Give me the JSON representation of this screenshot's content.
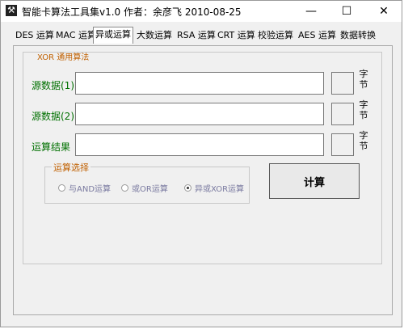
{
  "window": {
    "title": "智能卡算法工具集v1.0 作者：余彦飞 2010-08-25",
    "minimize_icon": "minimize-icon",
    "maximize_icon": "maximize-icon",
    "close_icon": "close-icon"
  },
  "tabs": [
    {
      "label": "DES 运算"
    },
    {
      "label": "MAC 运算"
    },
    {
      "label": "异或运算",
      "active": true
    },
    {
      "label": "大数运算"
    },
    {
      "label": "RSA 运算"
    },
    {
      "label": "CRT 运算"
    },
    {
      "label": "校验运算"
    },
    {
      "label": "AES 运算"
    },
    {
      "label": "数据转换"
    }
  ],
  "xor": {
    "group_title": "XOR 通用算法",
    "rows": [
      {
        "label": "源数据(1)",
        "value": "",
        "length": "",
        "unit": "字节"
      },
      {
        "label": "源数据(2)",
        "value": "",
        "length": "",
        "unit": "字节"
      },
      {
        "label": "运算结果",
        "value": "",
        "length": "",
        "unit": "字节"
      }
    ],
    "op_title": "运算选择",
    "options": [
      {
        "label": "与AND运算",
        "selected": false
      },
      {
        "label": "或OR运算",
        "selected": false
      },
      {
        "label": "异或XOR运算",
        "selected": true
      }
    ],
    "calc_label": "计算"
  }
}
